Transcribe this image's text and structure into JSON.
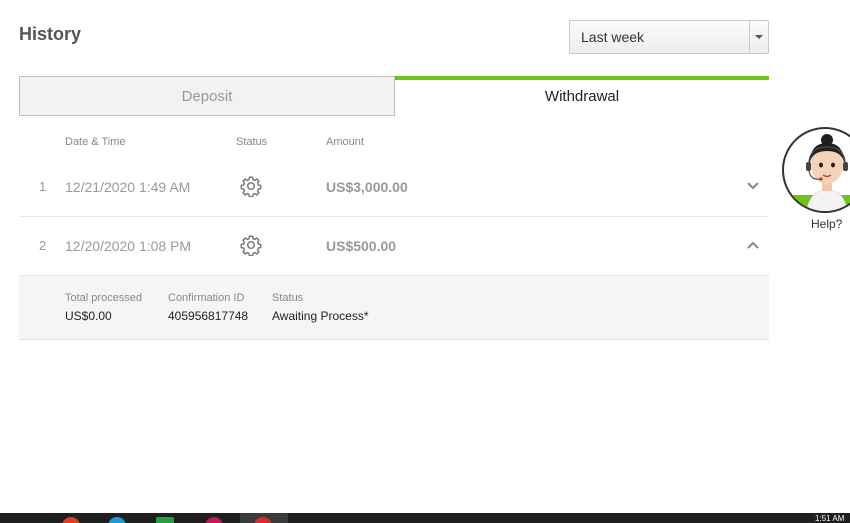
{
  "header": {
    "title": "History"
  },
  "period_select": {
    "value": "Last week"
  },
  "tabs": [
    {
      "label": "Deposit",
      "active": false
    },
    {
      "label": "Withdrawal",
      "active": true
    }
  ],
  "columns": {
    "date_time": "Date & Time",
    "status": "Status",
    "amount": "Amount"
  },
  "rows": [
    {
      "index": "1",
      "datetime": "12/21/2020 1:49 AM",
      "status_icon": "gear-icon",
      "amount": "US$3,000.00",
      "expanded": false
    },
    {
      "index": "2",
      "datetime": "12/20/2020 1:08 PM",
      "status_icon": "gear-icon",
      "amount": "US$500.00",
      "expanded": true
    }
  ],
  "details": {
    "total_processed_label": "Total processed",
    "total_processed_value": "US$0.00",
    "confirmation_label": "Confirmation ID",
    "confirmation_value": "405956817748",
    "status_label": "Status",
    "status_value": "Awaiting Process*"
  },
  "help": {
    "label": "Help?"
  },
  "taskbar": {
    "clock": "1:51 AM"
  },
  "colors": {
    "accent": "#6cc417",
    "muted_text": "#999999"
  }
}
